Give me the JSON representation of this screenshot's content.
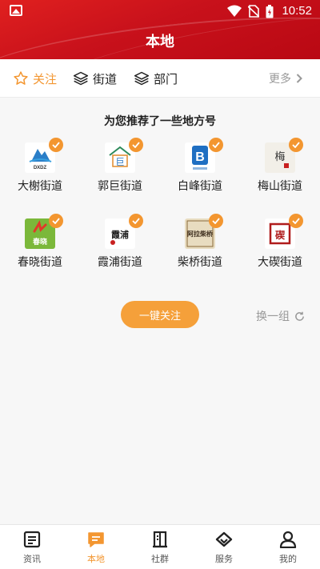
{
  "status_bar": {
    "time": "10:52"
  },
  "header": {
    "title": "本地"
  },
  "tabs": [
    {
      "label": "关注",
      "icon": "star-icon",
      "active": true
    },
    {
      "label": "街道",
      "icon": "layers-icon",
      "active": false
    },
    {
      "label": "部门",
      "icon": "layers-icon",
      "active": false
    }
  ],
  "more": {
    "label": "更多"
  },
  "recommend": {
    "title": "为您推荐了一些地方号",
    "items": [
      {
        "name": "大榭街道",
        "logo_text": "DXDZ"
      },
      {
        "name": "郭巨街道",
        "logo_text": "巨"
      },
      {
        "name": "白峰街道",
        "logo_text": "B"
      },
      {
        "name": "梅山街道",
        "logo_text": "梅"
      },
      {
        "name": "春晓街道",
        "logo_text": "春晓"
      },
      {
        "name": "霞浦街道",
        "logo_text": "霞浦"
      },
      {
        "name": "柴桥街道",
        "logo_text": "阿拉柴桥"
      },
      {
        "name": "大碶街道",
        "logo_text": "碶"
      }
    ],
    "follow_all": "一键关注",
    "refresh": "换一组"
  },
  "bottom_nav": [
    {
      "label": "资讯",
      "icon": "news-icon",
      "active": false
    },
    {
      "label": "本地",
      "icon": "chat-icon",
      "active": true
    },
    {
      "label": "社群",
      "icon": "building-icon",
      "active": false
    },
    {
      "label": "服务",
      "icon": "diamond-icon",
      "active": false
    },
    {
      "label": "我的",
      "icon": "user-icon",
      "active": false
    }
  ],
  "colors": {
    "accent": "#f39630",
    "header_red": "#c8111b"
  }
}
